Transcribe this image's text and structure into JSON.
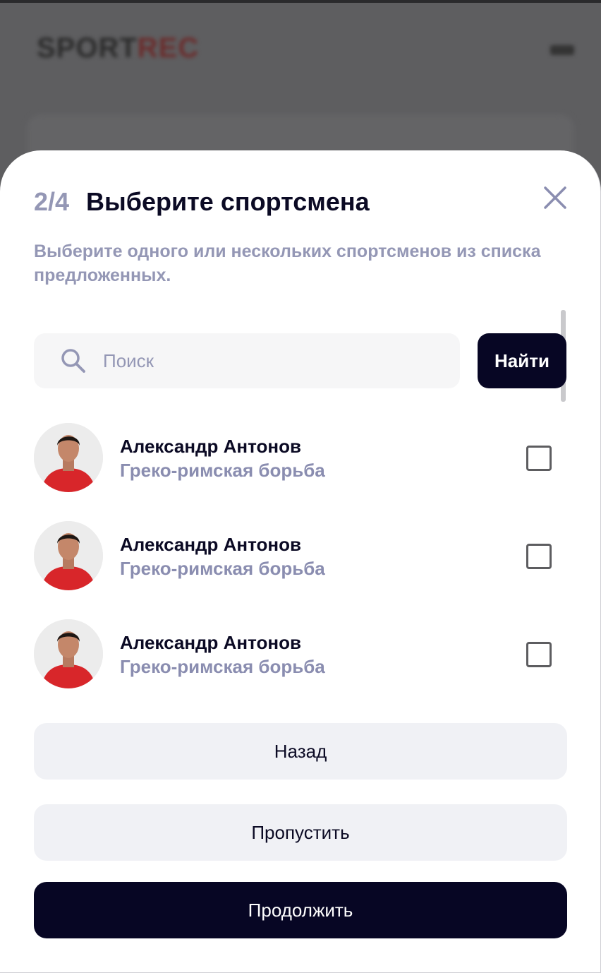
{
  "background": {
    "logo_dark": "SPORT",
    "logo_red": "REC"
  },
  "modal": {
    "step": "2/4",
    "title": "Выберите спортсмена",
    "subtitle": "Выберите одного или нескольких спортсменов из списка предложенных.",
    "search": {
      "placeholder": "Поиск",
      "value": "",
      "button_label": "Найти"
    },
    "athletes": [
      {
        "name": "Александр Антонов",
        "sport": "Греко-римская борьба",
        "checked": false
      },
      {
        "name": "Александр Антонов",
        "sport": "Греко-римская борьба",
        "checked": false
      },
      {
        "name": "Александр Антонов",
        "sport": "Греко-римская борьба",
        "checked": false
      }
    ],
    "buttons": {
      "back": "Назад",
      "skip": "Пропустить",
      "continue": "Продолжить"
    }
  },
  "colors": {
    "accent_dark": "#070624",
    "muted": "#9497b5",
    "light_button": "#f0f1f5"
  },
  "icons": [
    "search-icon",
    "close-icon",
    "checkbox-icon"
  ]
}
